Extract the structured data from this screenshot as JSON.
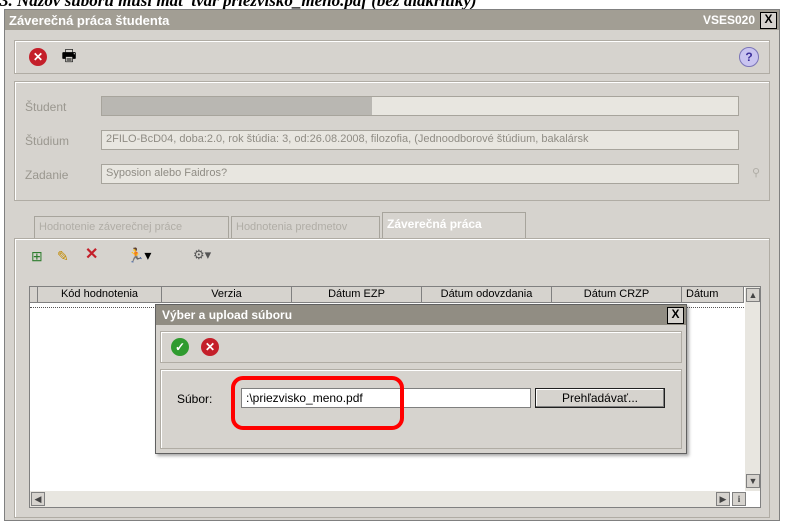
{
  "caption": "3. Názov súboru musí mať tvar priezvisko_meno.pdf (bez diakritiky)",
  "window": {
    "title": "Záverečná práca študenta",
    "code": "VSES020",
    "close": "X"
  },
  "toolbar_top": {
    "cancel_icon": "cancel-icon",
    "print_icon": "print-icon",
    "help_icon": "help-icon"
  },
  "student_info": {
    "student_label": "Študent",
    "student_value": "",
    "study_label": "Štúdium",
    "study_value": "2FILO-BcD04, doba:2.0, rok štúdia: 3, od:26.08.2008, filozofia, (Jednoodborové štúdium, bakalársk",
    "task_label": "Zadanie",
    "task_value": "Syposion alebo Faidros?"
  },
  "tabs": [
    {
      "label": "Hodnotenie záverečnej práce"
    },
    {
      "label": "Hodnotenia predmetov"
    },
    {
      "label": "Záverečná práca"
    }
  ],
  "grid_toolbar": {
    "add_icon": "add-icon",
    "edit_icon": "pencil-icon",
    "delete_icon": "delete-icon",
    "run_icon": "run-icon",
    "tools_icon": "tools-icon"
  },
  "table": {
    "columns": [
      "Kód hodnotenia",
      "Verzia",
      "Dátum EZP",
      "Dátum odovzdania",
      "Dátum CRZP",
      "Dátum"
    ]
  },
  "dialog": {
    "title": "Výber a upload súboru",
    "close": "X",
    "file_label": "Súbor:",
    "file_value": ":\\priezvisko_meno.pdf",
    "browse_label": "Prehľadávať..."
  },
  "colors": {
    "highlight": "#ff0000",
    "title_bar": "#a29e94",
    "dialog_title_bar": "#918d83"
  }
}
